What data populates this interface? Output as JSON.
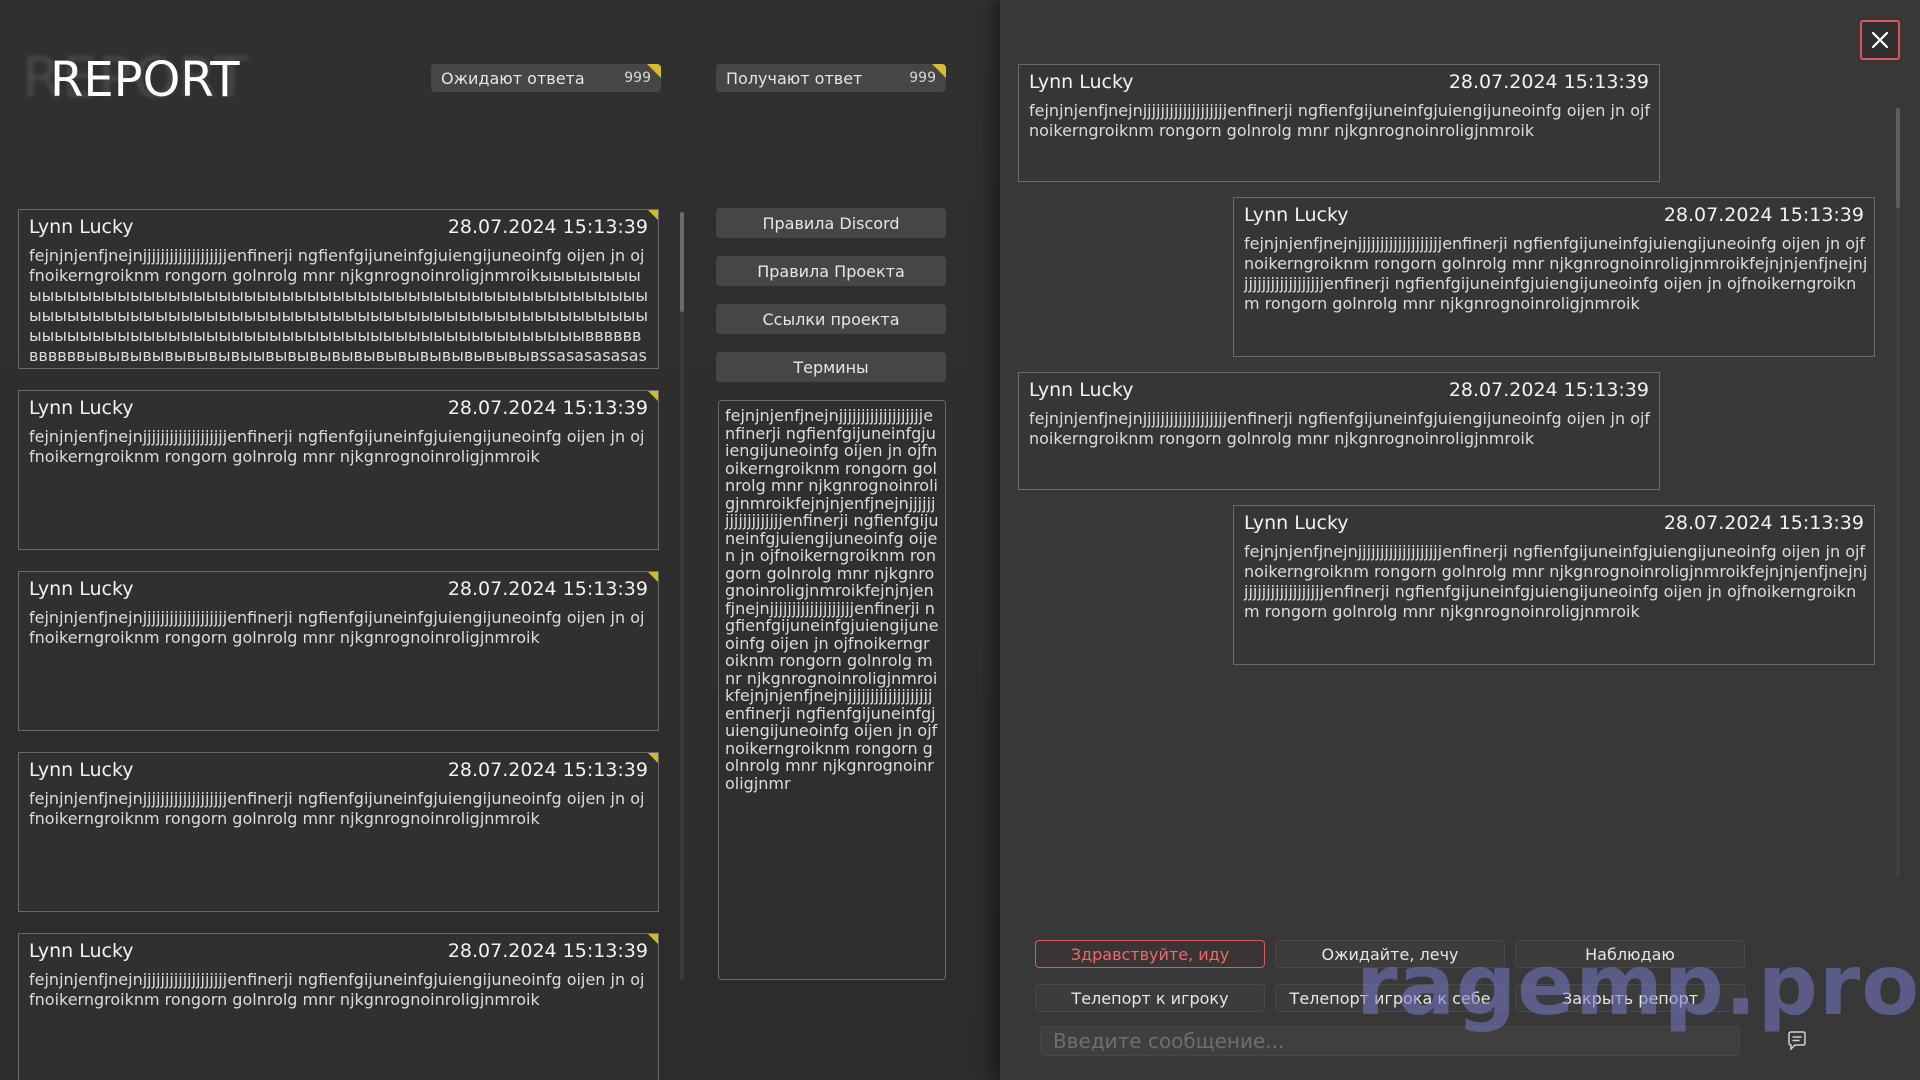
{
  "header": {
    "title": "REPORT",
    "title_ghost": "REPORT",
    "counters": [
      {
        "label": "Ожидают ответа",
        "value": "999"
      },
      {
        "label": "Получают ответ",
        "value": "999"
      }
    ]
  },
  "reports": [
    {
      "name": "Lynn Lucky",
      "date": "28.07.2024 15:13:39",
      "text": "fejnjnjenfjnejnjjjjjjjjjjjjjjjjjjjenfinerji ngfienfgijuneinfgjuiengijuneoinfg oijen  jn ojfnoikerngroiknm rongorn golnrolg mnr njkgnrognoinroligjnmroikыыыыыыыыыыыыыыыыыыыыыыыыыыыыыыыыыыыыыыыыыыыыыыыыыыыыыыыыыыыыыыыыыыыыыыыыыыыыыыыыыыыыыыыыыыыыыыыыыыыыыыыыыыыыыыыыыыыыыыыыыыыыыыыыыыыыыыыыыыыыыыыыыыыыыыввввввввввввывывывывывывывыывывывывывывывывывывывывывssasasasasasasasasasasы"
    },
    {
      "name": "Lynn Lucky",
      "date": "28.07.2024 15:13:39",
      "text": "fejnjnjenfjnejnjjjjjjjjjjjjjjjjjjjenfinerji ngfienfgijuneinfgjuiengijuneoinfg oijen  jn ojfnoikerngroiknm rongorn golnrolg mnr njkgnrognoinroligjnmroik"
    },
    {
      "name": "Lynn Lucky",
      "date": "28.07.2024 15:13:39",
      "text": "fejnjnjenfjnejnjjjjjjjjjjjjjjjjjjjenfinerji ngfienfgijuneinfgjuiengijuneoinfg oijen  jn ojfnoikerngroiknm rongorn golnrolg mnr njkgnrognoinroligjnmroik"
    },
    {
      "name": "Lynn Lucky",
      "date": "28.07.2024 15:13:39",
      "text": "fejnjnjenfjnejnjjjjjjjjjjjjjjjjjjjenfinerji ngfienfgijuneinfgjuiengijuneoinfg oijen  jn ojfnoikerngroiknm rongorn golnrolg mnr njkgnrognoinroligjnmroik"
    },
    {
      "name": "Lynn Lucky",
      "date": "28.07.2024 15:13:39",
      "text": "fejnjnjenfjnejnjjjjjjjjjjjjjjjjjjjenfinerji ngfienfgijuneinfgjuiengijuneoinfg oijen  jn ojfnoikerngroiknm rongorn golnrolg mnr njkgnrognoinroligjnmroik"
    }
  ],
  "rules": {
    "buttons": [
      "Правила Discord",
      "Правила Проекта",
      "Ссылки проекта",
      "Термины"
    ],
    "terms_text": "fejnjnjenfjnejnjjjjjjjjjjjjjjjjjjjenfinerji ngfienfgijuneinfgjuiengijuneoinfg oijen  jn ojfnoikerngroiknm rongorn golnrolg mnr njkgnrognoinroligjnmroikfejnjnjenfjnejnjjjjjjjjjjjjjjjjjjjenfinerji ngfienfgijuneinfgjuiengijuneoinfg oijen  jn ojfnoikerngroiknm rongorn golnrolg mnr njkgnrognoinroligjnmroikfejnjnjenfjnejnjjjjjjjjjjjjjjjjjjjenfinerji ngfienfgijuneinfgjuiengijuneoinfg oijen  jn ojfnoikerngroiknm rongorn golnrolg mnr njkgnrognoinroligjnmroikfejnjnjenfjnejnjjjjjjjjjjjjjjjjjjjenfinerji ngfienfgijuneinfgjuiengijuneoinfg oijen  jn ojfnoikerngroiknm rongorn golnrolg mnr njkgnrognoinroligjnmr"
  },
  "chat": {
    "messages": [
      {
        "name": "Lynn Lucky",
        "date": "28.07.2024 15:13:39",
        "text": "fejnjnjenfjnejnjjjjjjjjjjjjjjjjjjjenfinerji ngfienfgijuneinfgjuiengijuneoinfg oijen  jn ojfnoikerngroiknm rongorn golnrolg mnr njkgnrognoinroligjnmroik"
      },
      {
        "name": "Lynn Lucky",
        "date": "28.07.2024 15:13:39",
        "text": "fejnjnjenfjnejnjjjjjjjjjjjjjjjjjjjenfinerji ngfienfgijuneinfgjuiengijuneoinfg oijen  jn ojfnoikerngroiknm rongorn golnrolg mnr njkgnrognoinroligjnmroikfejnjnjenfjnejnjjjjjjjjjjjjjjjjjjjenfinerji ngfienfgijuneinfgjuiengijuneoinfg oijen  jn ojfnoikerngroiknm rongorn golnrolg mnr njkgnrognoinroligjnmroik"
      },
      {
        "name": "Lynn Lucky",
        "date": "28.07.2024 15:13:39",
        "text": "fejnjnjenfjnejnjjjjjjjjjjjjjjjjjjjenfinerji ngfienfgijuneinfgjuiengijuneoinfg oijen  jn ojfnoikerngroiknm rongorn golnrolg mnr njkgnrognoinroligjnmroik"
      },
      {
        "name": "Lynn Lucky",
        "date": "28.07.2024 15:13:39",
        "text": "fejnjnjenfjnejnjjjjjjjjjjjjjjjjjjjenfinerji ngfienfgijuneinfgjuiengijuneoinfg oijen  jn ojfnoikerngroiknm rongorn golnrolg mnr njkgnrognoinroligjnmroikfejnjnjenfjnejnjjjjjjjjjjjjjjjjjjjenfinerji ngfienfgijuneinfgjuiengijuneoinfg oijen  jn ojfnoikerngroiknm rongorn golnrolg mnr njkgnrognoinroligjnmroik"
      }
    ],
    "quick_actions": [
      "Здравствуйте, иду",
      "Ожидайте, лечу",
      "Наблюдаю",
      "Телепорт к игроку",
      "Телепорт игрока к себе",
      "Закрыть репорт"
    ],
    "input_placeholder": "Введите сообщение..."
  },
  "icons": {
    "close": "close-icon",
    "send": "chat-bubble-icon",
    "corner": "corner-flag-icon"
  },
  "colors": {
    "accent_red": "#e05555",
    "corner_yellow": "#e6c92f",
    "watermark": "#7878c8"
  },
  "watermark": "ragemp.pro"
}
